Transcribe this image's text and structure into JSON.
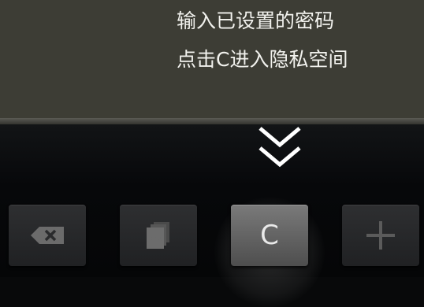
{
  "hint": {
    "line1": "输入已设置的密码",
    "line2": "点击C进入隐私空间"
  },
  "keys": {
    "delete_icon": "backspace-icon",
    "copy_icon": "copy-icon",
    "copy_text": "copy",
    "c_label": "C",
    "add_icon": "plus-icon"
  },
  "colors": {
    "panel": "#3d3d35",
    "background": "#08090a",
    "key": "#27282a",
    "key_active": "#6a6a6a"
  }
}
